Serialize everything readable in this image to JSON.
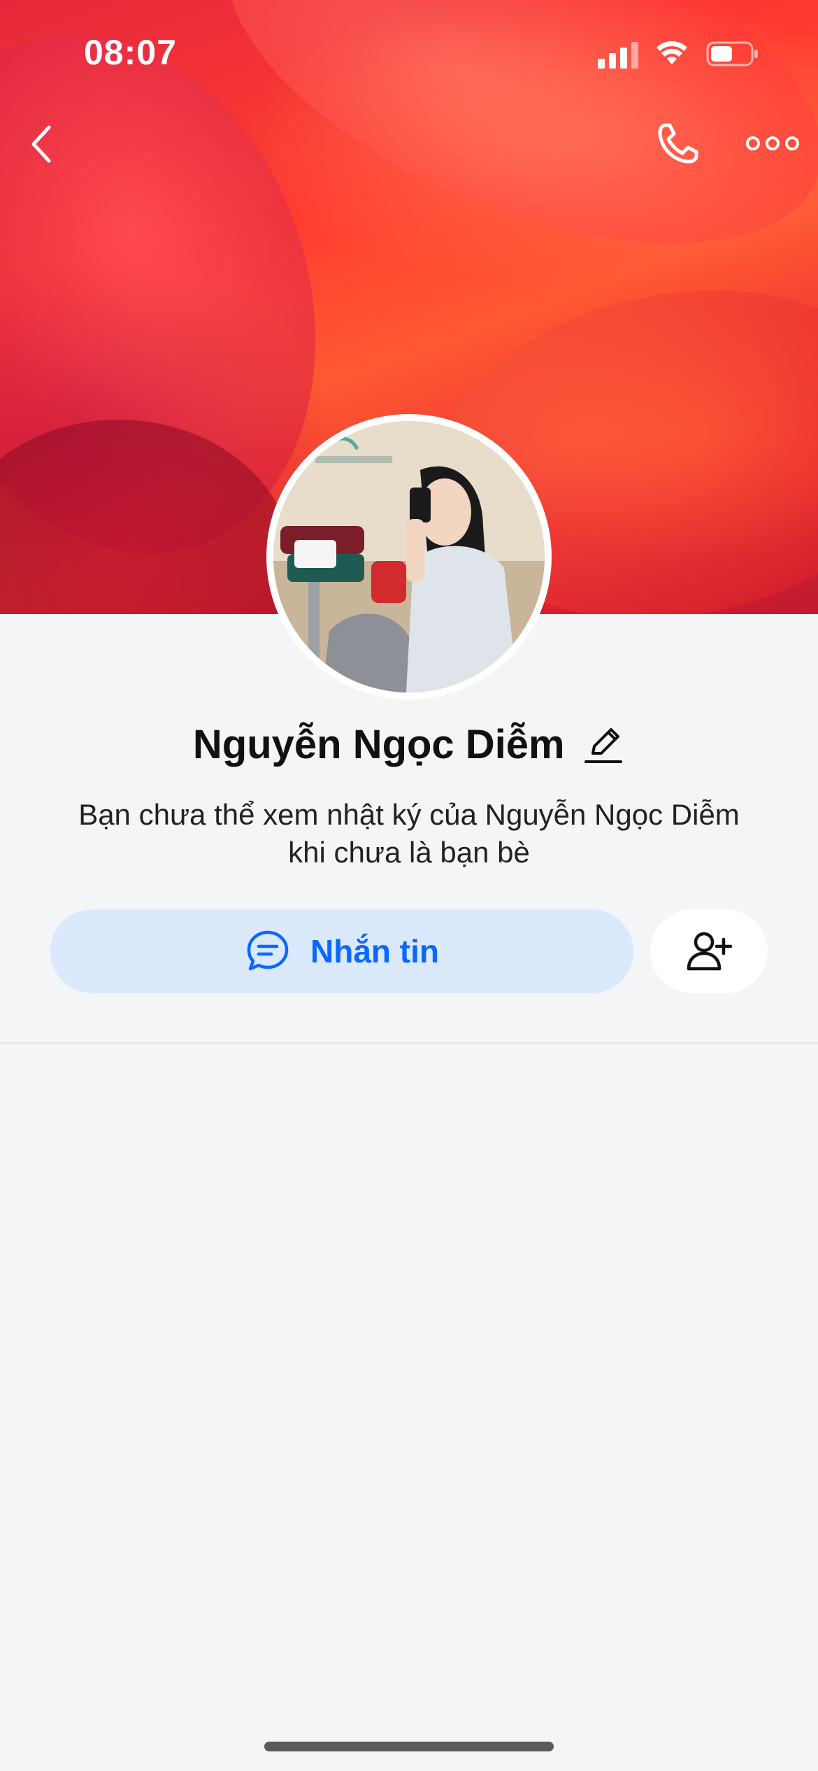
{
  "status_bar": {
    "time": "08:07"
  },
  "header": {
    "back_icon": "chevron-left-icon",
    "call_icon": "phone-icon",
    "more_icon": "more-horizontal-icon"
  },
  "profile": {
    "name": "Nguyễn Ngọc Diễm",
    "notice_line1": "Bạn chưa thể xem nhật ký của Nguyễn Ngọc Diễm",
    "notice_line2": "khi chưa là bạn bè"
  },
  "actions": {
    "message_label": "Nhắn tin",
    "message_icon": "chat-bubble-icon",
    "add_friend_icon": "user-plus-icon"
  },
  "colors": {
    "accent": "#0a68ff",
    "message_button_bg": "#dbe9fd",
    "page_bg": "#f4f5f7"
  }
}
